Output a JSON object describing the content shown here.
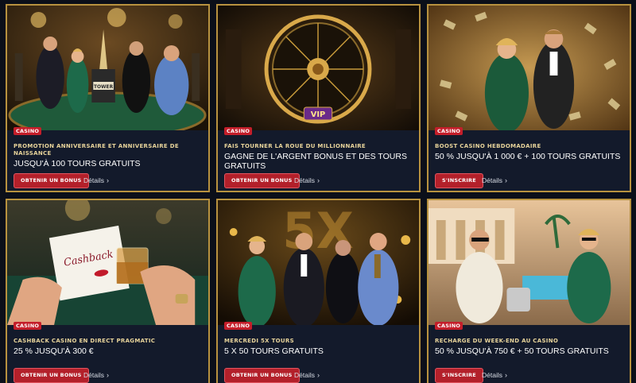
{
  "cards": [
    {
      "badge": "CASINO",
      "title": "PROMOTION ANNIVERSAIRE ET ANNIVERSAIRE DE NAISSANCE",
      "subtitle": "JUSQU'À 100 TOURS GRATUITS",
      "button": "OBTENIR UN BONUS",
      "details": "Détails",
      "image_text": "TOWER"
    },
    {
      "badge": "CASINO",
      "title": "FAIS TOURNER LA ROUE DU MILLIONNAIRE",
      "subtitle": "GAGNE DE L'ARGENT BONUS ET DES TOURS GRATUITS",
      "button": "OBTENIR UN BONUS",
      "details": "Détails",
      "image_text": "VIP"
    },
    {
      "badge": "CASINO",
      "title": "BOOST CASINO HEBDOMADAIRE",
      "subtitle": "50 % JUSQU'À 1 000 € + 100 TOURS GRATUITS",
      "button": "S'INSCRIRE",
      "details": "Détails"
    },
    {
      "badge": "CASINO",
      "title": "CASHBACK CASINO EN DIRECT PRAGMATIC",
      "subtitle": "25 % JUSQU'À 300 €",
      "button": "OBTENIR UN BONUS",
      "details": "Détails",
      "image_text": "Cashback"
    },
    {
      "badge": "CASINO",
      "title": "MERCREDI 5X TOURS",
      "subtitle": "5 X 50 TOURS GRATUITS",
      "button": "OBTENIR UN BONUS",
      "details": "Détails",
      "image_text": "5X"
    },
    {
      "badge": "CASINO",
      "title": "RECHARGE DU WEEK-END AU CASINO",
      "subtitle": "50 % JUSQU'À 750 € + 50 TOURS GRATUITS",
      "button": "S'INSCRIRE",
      "details": "Détails"
    }
  ],
  "icons": {
    "details_chevron": "chevron-right-icon"
  },
  "colors": {
    "page_bg": "#0b0f19",
    "card_bg": "#131a2b",
    "card_border": "#b8923f",
    "title_gold": "#e7d39a",
    "badge_red": "#c41e2a",
    "button_red": "#b3202a"
  }
}
